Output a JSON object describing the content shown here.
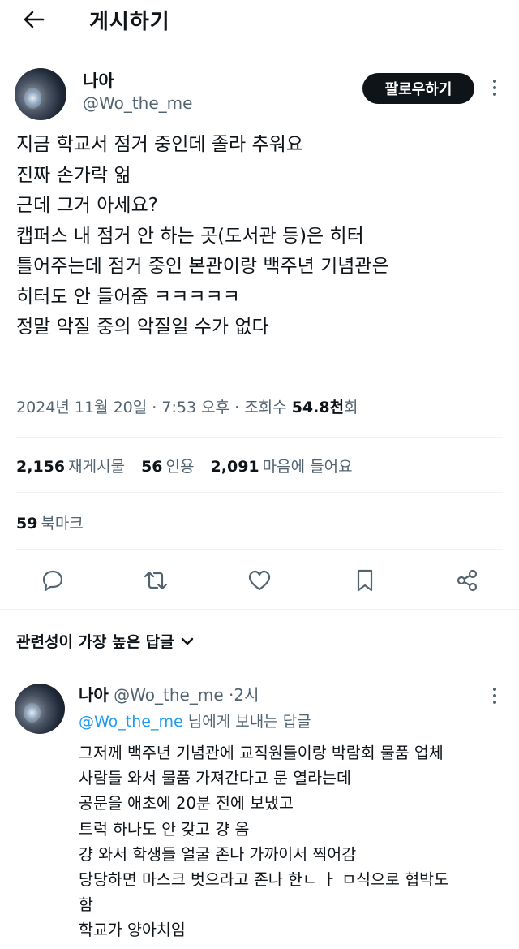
{
  "header": {
    "title": "게시하기",
    "back_icon": "arrow-left-icon"
  },
  "post": {
    "author_name": "나아",
    "author_handle": "@Wo_the_me",
    "follow_label": "팔로우하기",
    "lines": [
      "지금 학교서 점거 중인데 졸라 추워요",
      "진짜 손가락 얾",
      "근데 그거 아세요?",
      "캡퍼스 내 점거 안 하는 곳(도서관 등)은 히터",
      "틀어주는데 점거 중인 본관이랑 백주년 기념관은",
      "히터도 안 들어줌 ㅋㅋㅋㅋㅋ",
      "정말 악질 중의 악질일 수가 없다"
    ],
    "meta": {
      "date": "2024년 11월 20일",
      "time": "7:53 오후",
      "views_label": "조회수",
      "views_value": "54.8천",
      "views_suffix": "회",
      "sep": "·"
    },
    "stats": {
      "retweets": "2,156",
      "retweets_label": "재게시물",
      "quotes": "56",
      "quotes_label": "인용",
      "likes": "2,091",
      "likes_label": "마음에 들어요",
      "bookmarks": "59",
      "bookmarks_label": "북마크"
    },
    "actions": [
      "reply-icon",
      "retweet-icon",
      "like-icon",
      "bookmark-icon",
      "share-icon"
    ]
  },
  "replies_section": {
    "sort_label": "관련성이 가장 높은 답글"
  },
  "reply": {
    "author_name": "나아",
    "author_handle": "@Wo_the_me",
    "sep": "·",
    "time": "2시",
    "replying_to_handle": "@Wo_the_me",
    "replying_to_suffix": "님에게 보내는 답글",
    "lines": [
      "그저께 백주년 기념관에 교직원들이랑 박람회 물품 업체",
      "사람들 와서 물품 가져간다고 문 열라는데",
      "공문을 애초에 20분 전에 보냈고",
      "트럭 하나도 안 갖고 걍 옴",
      "걍 와서 학생들 얼굴 존나 가까이서 찍어감",
      "당당하면 마스크 벗으라고 존나 한ㄴ ㅏ ㅁ식으로 협박도",
      "함",
      "학교가 양아치임"
    ]
  },
  "colors": {
    "text": "#0f1419",
    "secondary": "#536471",
    "link": "#1d9bf0",
    "divider": "#eff3f4"
  }
}
